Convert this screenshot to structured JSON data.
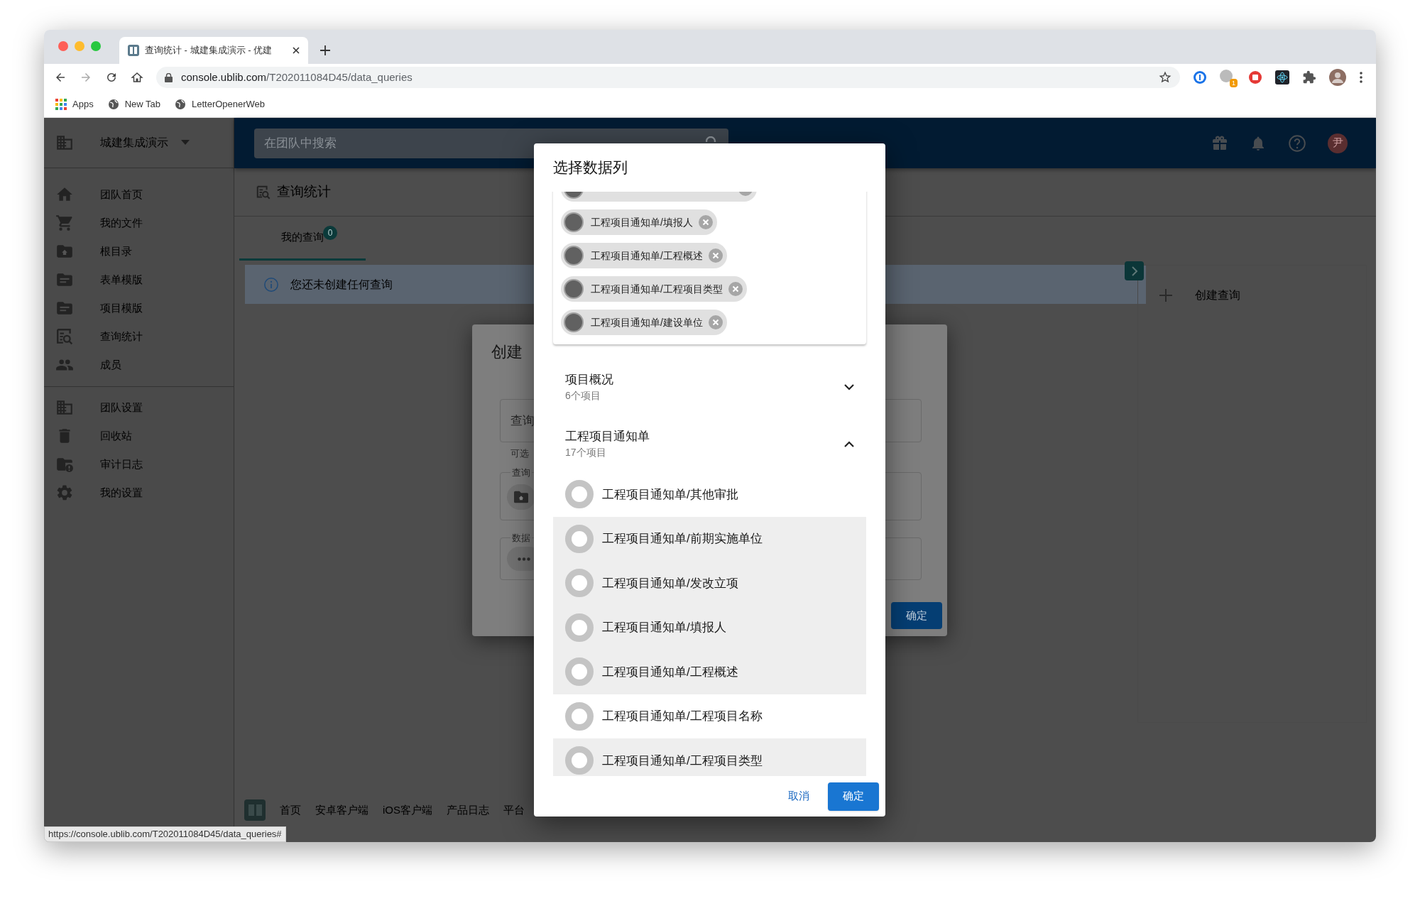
{
  "browser": {
    "tab_title": "查询统计 - 城建集成演示 - 优建",
    "url_domain": "console.ublib.com",
    "url_path": "/T202011084D45/data_queries",
    "extension_badge": "1",
    "bookmarks": [
      "Apps",
      "New Tab",
      "LetterOpenerWeb"
    ]
  },
  "sidebar": {
    "team": "城建集成演示",
    "groups": [
      [
        "团队首页",
        "我的文件",
        "根目录",
        "表单模版",
        "项目模版",
        "查询统计",
        "成员"
      ],
      [
        "团队设置",
        "回收站",
        "审计日志",
        "我的设置"
      ]
    ]
  },
  "topbar": {
    "search_placeholder": "在团队中搜索",
    "avatar": "尹"
  },
  "page": {
    "title": "查询统计",
    "tabs": [
      {
        "label": "我的查询",
        "badge": "0",
        "selected": true
      }
    ],
    "notice": "您还未创建任何查询",
    "side_action": "创建查询"
  },
  "footer_links": [
    "首页",
    "安卓客户端",
    "iOS客户端",
    "产品日志",
    "平台"
  ],
  "status_url": "https://console.ublib.com/T202011084D45/data_queries#",
  "create_dialog": {
    "title": "创建",
    "name_placeholder": "查询",
    "helper": "可选",
    "location_label": "查询",
    "columns_label": "数据",
    "confirm": "确定"
  },
  "column_dialog": {
    "title": "选择数据列",
    "chips": [
      "工程项目通知单/填报人",
      "工程项目通知单/工程概述",
      "工程项目通知单/工程项目类型",
      "工程项目通知单/建设单位"
    ],
    "groups": [
      {
        "title": "项目概况",
        "count": "6个项目",
        "expanded": false
      },
      {
        "title": "工程项目通知单",
        "count": "17个项目",
        "expanded": true,
        "items": [
          {
            "label": "工程项目通知单/其他审批",
            "selected": false
          },
          {
            "label": "工程项目通知单/前期实施单位",
            "selected": true
          },
          {
            "label": "工程项目通知单/发改立项",
            "selected": true
          },
          {
            "label": "工程项目通知单/填报人",
            "selected": true
          },
          {
            "label": "工程项目通知单/工程概述",
            "selected": true
          },
          {
            "label": "工程项目通知单/工程项目名称",
            "selected": false
          },
          {
            "label": "工程项目通知单/工程项目类型",
            "selected": true
          }
        ]
      }
    ],
    "cancel": "取消",
    "confirm": "确定"
  }
}
